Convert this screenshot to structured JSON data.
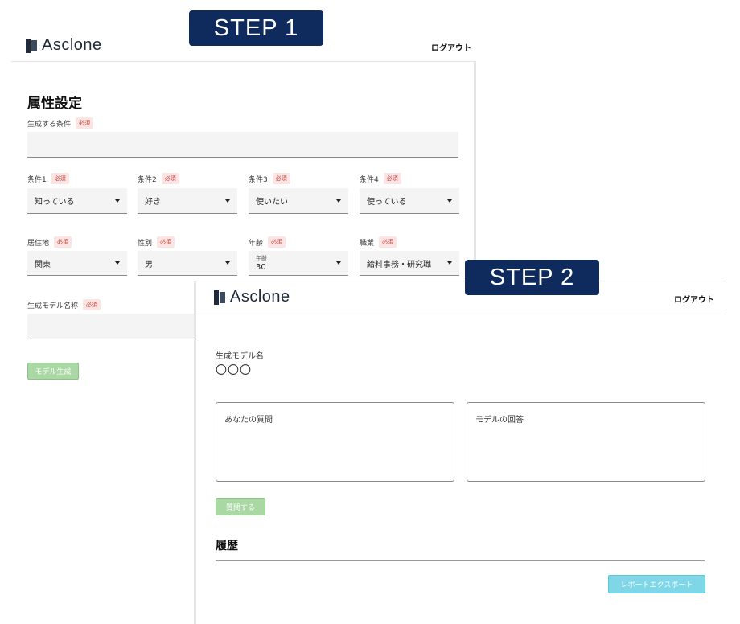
{
  "step1": {
    "badge": "STEP 1",
    "logo": "Asclone",
    "logout": "ログアウト",
    "title": "属性設定",
    "required_tag": "必須",
    "condition_generate": {
      "label": "生成する条件",
      "value": ""
    },
    "conditions": [
      {
        "label": "条件1",
        "value": "知っている"
      },
      {
        "label": "条件2",
        "value": "好き"
      },
      {
        "label": "条件3",
        "value": "使いたい"
      },
      {
        "label": "条件4",
        "value": "使っている"
      }
    ],
    "attributes": [
      {
        "label": "居住地",
        "value": "関東",
        "sub_label": ""
      },
      {
        "label": "性別",
        "value": "男",
        "sub_label": ""
      },
      {
        "label": "年齢",
        "value": "30",
        "sub_label": "年齢"
      },
      {
        "label": "職業",
        "value": "給料事務・研究職",
        "sub_label": ""
      }
    ],
    "model_name": {
      "label": "生成モデル名称",
      "value": ""
    },
    "generate_button": "モデル生成"
  },
  "step2": {
    "badge": "STEP 2",
    "logo": "Asclone",
    "logout": "ログアウト",
    "model_name_label": "生成モデル名",
    "model_name_value": "〇〇〇",
    "question_placeholder": "あなたの質問",
    "answer_placeholder": "モデルの回答",
    "ask_button": "質問する",
    "history_title": "履歴",
    "export_button": "レポートエクスポート"
  }
}
